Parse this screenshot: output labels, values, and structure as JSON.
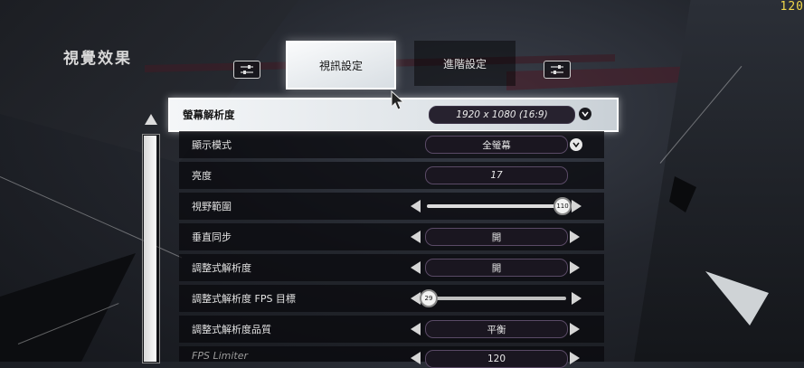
{
  "hud": {
    "fps_counter": "120"
  },
  "section": {
    "title": "視覺效果"
  },
  "tabs": [
    {
      "label": "視訊設定",
      "active": true
    },
    {
      "label": "進階設定",
      "active": false
    }
  ],
  "settings": [
    {
      "label": "螢幕解析度",
      "value": "1920 x 1080 (16:9)",
      "control": "dropdown",
      "selected": true
    },
    {
      "label": "顯示模式",
      "value": "全螢幕",
      "control": "dropdown"
    },
    {
      "label": "亮度",
      "value": "17",
      "control": "stepper"
    },
    {
      "label": "視野範圍",
      "value": "110",
      "control": "slider",
      "fraction": 0.92
    },
    {
      "label": "垂直同步",
      "value": "開",
      "control": "stepper"
    },
    {
      "label": "調整式解析度",
      "value": "開",
      "control": "stepper"
    },
    {
      "label": "調整式解析度 FPS 目標",
      "value": "29",
      "control": "slider",
      "fraction": 0.05
    },
    {
      "label": "調整式解析度品質",
      "value": "平衡",
      "control": "stepper"
    },
    {
      "label": "FPS Limiter",
      "value": "120",
      "control": "stepper"
    }
  ],
  "colors": {
    "fps": "#f2d94a",
    "accent": "#ffffff",
    "field_border": "#5a4a66"
  }
}
